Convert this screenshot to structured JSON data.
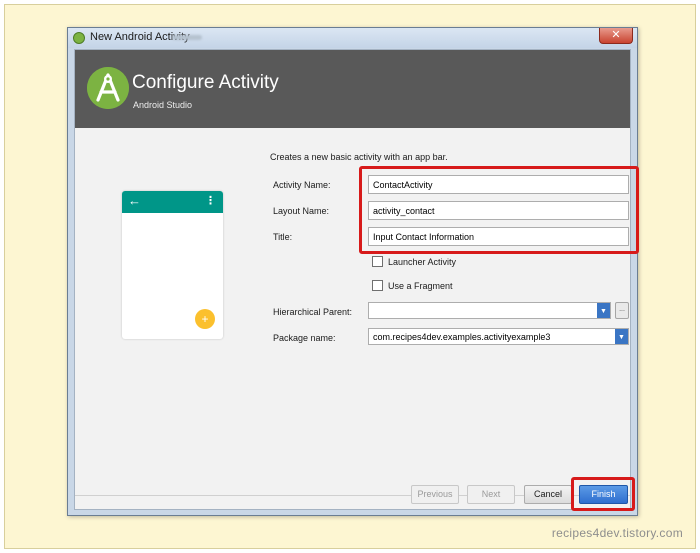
{
  "window": {
    "title": "New Android Activity",
    "close_glyph": "✕"
  },
  "header": {
    "title": "Configure Activity",
    "subtitle": "Android Studio"
  },
  "preview": {
    "back_glyph": "←",
    "menu_glyph": "⋮",
    "fab_glyph": "+"
  },
  "form": {
    "description": "Creates a new basic activity with an app bar.",
    "activity_name_label": "Activity Name:",
    "activity_name_value": "ContactActivity",
    "layout_name_label": "Layout Name:",
    "layout_name_value": "activity_contact",
    "title_label": "Title:",
    "title_value": "Input Contact Information",
    "launcher_activity_label": "Launcher Activity",
    "launcher_activity_checked": false,
    "use_fragment_label": "Use a Fragment",
    "use_fragment_checked": false,
    "hierarchical_parent_label": "Hierarchical Parent:",
    "hierarchical_parent_value": "",
    "browse_label": "...",
    "package_name_label": "Package name:",
    "package_name_value": "com.recipes4dev.examples.activityexample3",
    "dropdown_glyph": "▼"
  },
  "buttons": {
    "previous": "Previous",
    "next": "Next",
    "cancel": "Cancel",
    "finish": "Finish"
  },
  "colors": {
    "header_bg": "#595959",
    "android_green": "#7cb342",
    "preview_bar": "#009688",
    "fab": "#fbc02d",
    "highlight": "#d71a1a",
    "primary_button": "#2f6fcf"
  },
  "watermark": "recipes4dev.tistory.com"
}
